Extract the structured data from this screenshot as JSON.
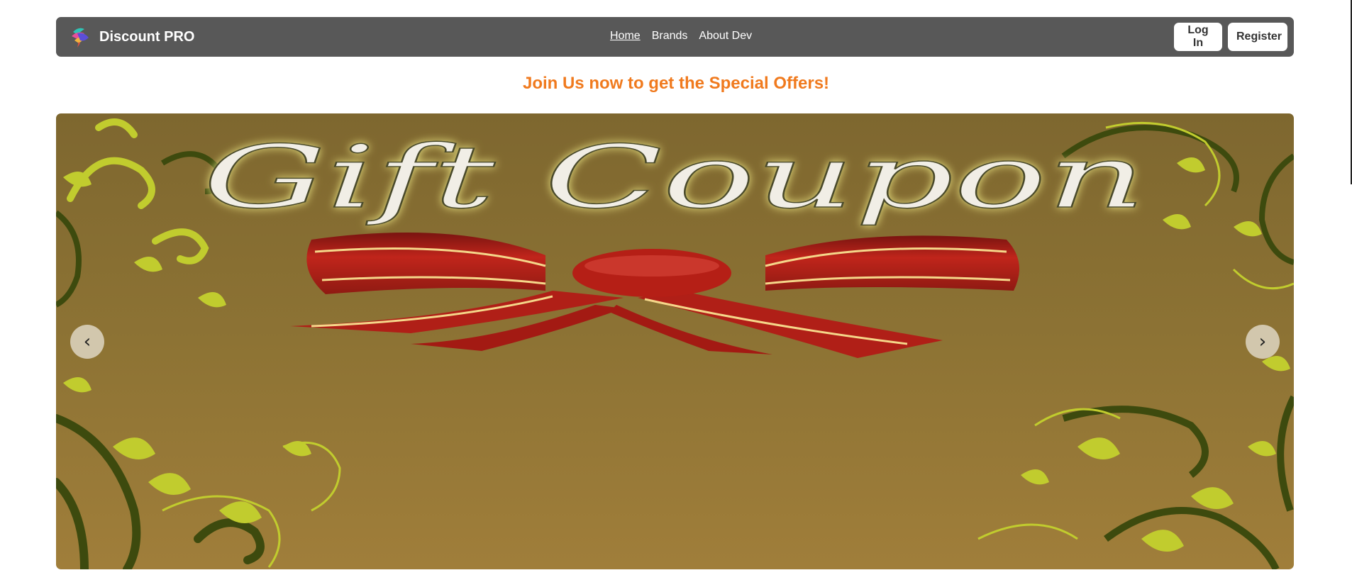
{
  "navbar": {
    "brand_name": "Discount PRO",
    "links": [
      {
        "label": "Home",
        "active": true
      },
      {
        "label": "Brands",
        "active": false
      },
      {
        "label": "About Dev",
        "active": false
      }
    ],
    "login_label": "Log In",
    "register_label": "Register",
    "background_color": "#585858"
  },
  "promo": {
    "text": "Join Us now to get the Special Offers!",
    "color": "#f07a1e"
  },
  "carousel": {
    "slide_title": "Gift Coupon",
    "prev_label": "‹",
    "next_label": "›"
  }
}
